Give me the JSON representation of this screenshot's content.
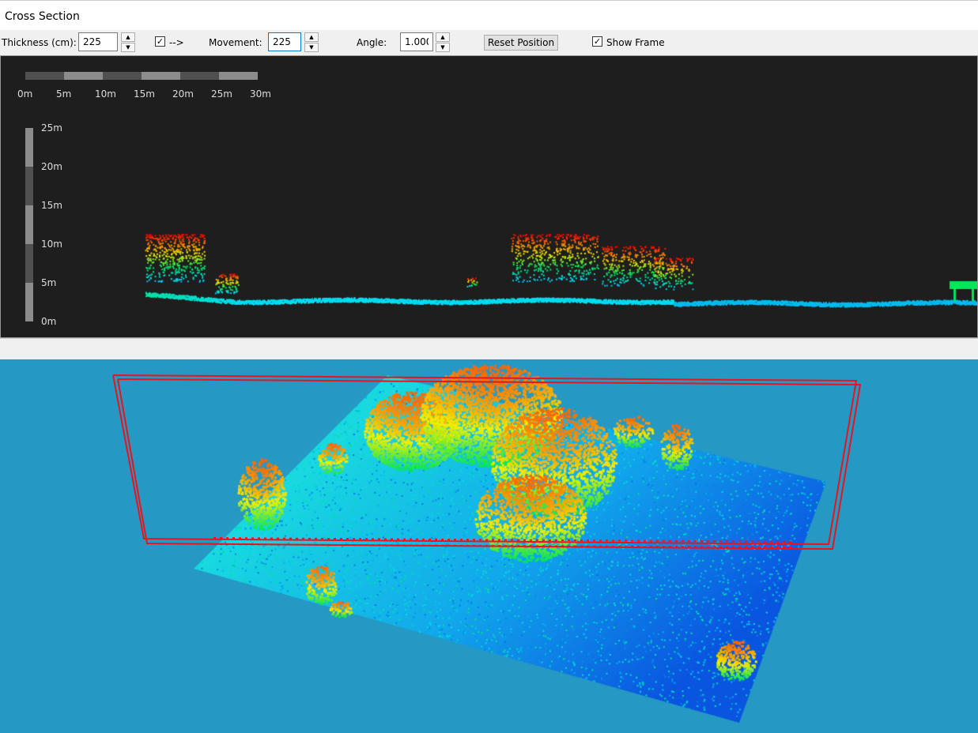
{
  "window": {
    "title": "Cross Section"
  },
  "toolbar": {
    "thickness_label": "Thickness (cm):",
    "thickness_value": "225",
    "direction_checkbox_label": "-->",
    "direction_checked": true,
    "movement_label": "Movement:",
    "movement_value": "225",
    "angle_label": "Angle:",
    "angle_value": "1.000",
    "reset_label": "Reset Position",
    "show_frame_label": "Show Frame",
    "show_frame_checked": true,
    "up_glyph": "▲",
    "down_glyph": "▼",
    "check_glyph": "✓"
  },
  "cross_section": {
    "horizontal_scale": [
      "0m",
      "5m",
      "10m",
      "15m",
      "20m",
      "25m",
      "30m"
    ],
    "vertical_scale": [
      "25m",
      "20m",
      "15m",
      "10m",
      "5m",
      "0m"
    ],
    "background": "#1e1e1e"
  },
  "view3d": {
    "background": "#2598c4",
    "frame_color": "#e8141e"
  }
}
